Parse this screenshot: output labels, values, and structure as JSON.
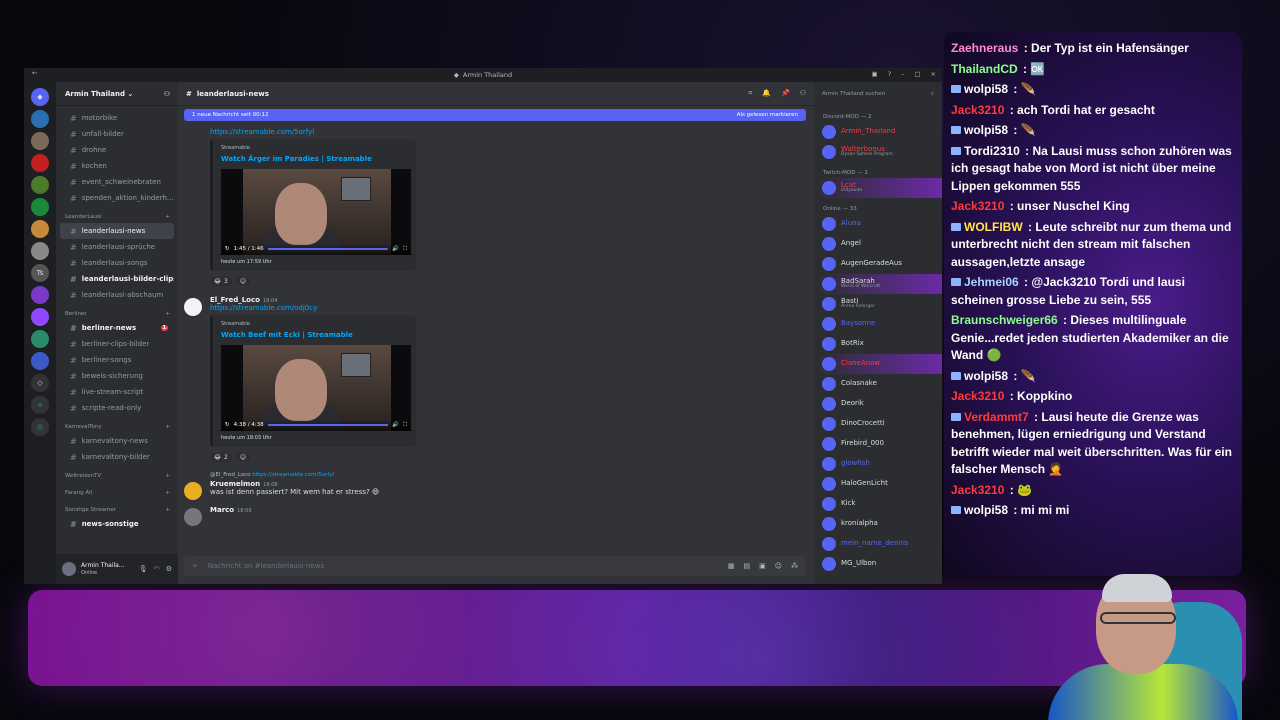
{
  "discord": {
    "window_title": "Armin Thailand",
    "guild_name": "Armin Thailand",
    "channels": [
      {
        "kind": "chan",
        "name": "motorbike"
      },
      {
        "kind": "chan",
        "name": "unfall-bilder"
      },
      {
        "kind": "chan",
        "name": "drohne"
      },
      {
        "kind": "chan",
        "name": "kochen"
      },
      {
        "kind": "chan",
        "name": "event_schweinebraten"
      },
      {
        "kind": "chan",
        "name": "spenden_aktion_kinderh..."
      },
      {
        "kind": "cat",
        "name": "LeanderLausi"
      },
      {
        "kind": "chan",
        "name": "leanderlausi-news",
        "active": true
      },
      {
        "kind": "chan",
        "name": "leanderlausi-sprüche"
      },
      {
        "kind": "chan",
        "name": "leanderlausi-songs"
      },
      {
        "kind": "chan",
        "name": "leanderlausi-bilder-clips",
        "unread": true
      },
      {
        "kind": "chan",
        "name": "leanderlausi-abschaum"
      },
      {
        "kind": "cat",
        "name": "Berliner"
      },
      {
        "kind": "chan",
        "name": "berliner-news",
        "unread": true,
        "badge": "1"
      },
      {
        "kind": "chan",
        "name": "berliner-clips-bilder"
      },
      {
        "kind": "chan",
        "name": "berliner-songs"
      },
      {
        "kind": "chan",
        "name": "beweis-sicherung"
      },
      {
        "kind": "chan",
        "name": "live-stream-script"
      },
      {
        "kind": "chan",
        "name": "scripte-read-only"
      },
      {
        "kind": "cat",
        "name": "KarnevalTony"
      },
      {
        "kind": "chan",
        "name": "karnevaltony-news"
      },
      {
        "kind": "chan",
        "name": "karnevaltony-bilder"
      },
      {
        "kind": "cat",
        "name": "WeltreisenTV"
      },
      {
        "kind": "cat",
        "name": "Farang Ali"
      },
      {
        "kind": "cat",
        "name": "Sonstige Streamer"
      },
      {
        "kind": "chan",
        "name": "news-sonstige",
        "unread": true
      }
    ],
    "user": {
      "name": "Armin Thaila...",
      "status": "Online"
    },
    "channel_header": "leanderlausi-news",
    "new_bar": {
      "text": "1 neue Nachricht seit 00:12",
      "mark": "Als gelesen markieren"
    },
    "embed1": {
      "link": "https://streamable.com/5orfyl",
      "provider": "Streamable",
      "title": "Watch Ärger im Paradies | Streamable",
      "progress_text": "1:45 / 1:46",
      "progress": 0.99,
      "timestamp": "heute um 17:59 Uhr",
      "reaction": "3"
    },
    "msg2": {
      "author": "El_Fred_Loco",
      "time": "18:04",
      "link": "https://streamable.com/odj0cy",
      "provider": "Streamable",
      "title": "Watch Beef mit Ecki | Streamable",
      "progress_text": "4:38 / 4:38",
      "progress": 1.0,
      "timestamp": "heute um 18:03 Uhr",
      "reaction": "2"
    },
    "reply": {
      "ref_author": "@El_Fred_Loco",
      "ref_text": "https://streamable.com/5orfyl"
    },
    "msg3": {
      "author": "Kruemelmon",
      "time": "18:08",
      "text": "was ist denn passiert? Mit wem hat er stress? 😄"
    },
    "msg4": {
      "author": "Marco",
      "time": "18:09"
    },
    "composer_placeholder": "Nachricht an #leanderlausi-news",
    "member_search": "Armin Thailand suchen",
    "members": [
      {
        "kind": "cat",
        "name": "Discord-MOD — 2"
      },
      {
        "kind": "mem",
        "name": "Armin_Thailand",
        "color": "#f23f43"
      },
      {
        "kind": "mem",
        "name": "Walterbonus",
        "sub": "Dyson Sphere Program",
        "color": "#f23f43"
      },
      {
        "kind": "cat",
        "name": "Twitch-MOD — 1"
      },
      {
        "kind": "mem",
        "name": "Lcat",
        "sub": "irl4youdo",
        "color": "#f23f43",
        "boost": true
      },
      {
        "kind": "cat",
        "name": "Online — 33"
      },
      {
        "kind": "mem",
        "name": "Aluna",
        "color": "#5865f2"
      },
      {
        "kind": "mem",
        "name": "Angel",
        "color": "#dbdee1"
      },
      {
        "kind": "mem",
        "name": "AugenGeradeAus",
        "color": "#dbdee1"
      },
      {
        "kind": "mem",
        "name": "BadSarah",
        "sub": "World of Warcraft",
        "color": "#dbdee1",
        "boost": true
      },
      {
        "kind": "mem",
        "name": "Basti",
        "sub": "Arena Reforger",
        "color": "#dbdee1"
      },
      {
        "kind": "mem",
        "name": "Baysonne",
        "color": "#5865f2"
      },
      {
        "kind": "mem",
        "name": "BotRix",
        "color": "#dbdee1",
        "tag": "APP"
      },
      {
        "kind": "mem",
        "name": "ClaneAnow",
        "color": "#f23f43",
        "boost": true
      },
      {
        "kind": "mem",
        "name": "Colasnake",
        "color": "#dbdee1"
      },
      {
        "kind": "mem",
        "name": "Deorik",
        "color": "#dbdee1"
      },
      {
        "kind": "mem",
        "name": "DinoCrocetti",
        "color": "#dbdee1"
      },
      {
        "kind": "mem",
        "name": "Firebird_000",
        "color": "#dbdee1"
      },
      {
        "kind": "mem",
        "name": "glowfish",
        "color": "#5865f2"
      },
      {
        "kind": "mem",
        "name": "HaloGenLicht",
        "color": "#dbdee1"
      },
      {
        "kind": "mem",
        "name": "Kick",
        "color": "#dbdee1",
        "tag": "APP"
      },
      {
        "kind": "mem",
        "name": "kronialpha",
        "color": "#dbdee1"
      },
      {
        "kind": "mem",
        "name": "mein_name_dennis",
        "color": "#5865f2"
      },
      {
        "kind": "mem",
        "name": "MG_Ulbon",
        "color": "#dbdee1"
      }
    ]
  },
  "chat": [
    {
      "user": "Zaehneraus",
      "color": "#ff8ad8",
      "text": " : Der Typ ist ein Hafensänger"
    },
    {
      "user": "ThailandCD",
      "color": "#8cff8c",
      "text": " : 🆗"
    },
    {
      "user": "wolpi58",
      "color": "#ffffff",
      "text": " : 🪶",
      "icon": true
    },
    {
      "user": "Jack3210",
      "color": "#ff3b3b",
      "text": " : ach Tordi hat er gesacht"
    },
    {
      "user": "wolpi58",
      "color": "#ffffff",
      "text": " : 🪶",
      "icon": true
    },
    {
      "user": "Tordi2310",
      "color": "#ffffff",
      "text": " : Na Lausi muss schon zuhören was ich gesagt habe von Mord ist nicht über meine Lippen gekommen 555",
      "icon": true
    },
    {
      "user": "Jack3210",
      "color": "#ff3b3b",
      "text": " : unser Nuschel King"
    },
    {
      "user": "WOLFIBW",
      "color": "#ffe44d",
      "text": " : Leute schreibt nur zum thema und unterbrecht nicht den stream mit falschen aussagen,letzte ansage",
      "icon": true
    },
    {
      "user": "Jehmei06",
      "color": "#a8d4ff",
      "text": " : @Jack3210 Tordi und lausi scheinen grosse Liebe zu sein, 555",
      "icon": true
    },
    {
      "user": "Braunschweiger66",
      "color": "#8cff8c",
      "text": " : Dieses multilinguale Genie...redet jeden studierten Akademiker an die Wand 🟢"
    },
    {
      "user": "wolpi58",
      "color": "#ffffff",
      "text": " : 🪶",
      "icon": true
    },
    {
      "user": "Jack3210",
      "color": "#ff3b3b",
      "text": " : Koppkino"
    },
    {
      "user": "Verdammt7",
      "color": "#ff3b3b",
      "text": " : Lausi heute die Grenze was benehmen, lügen erniedrigung und Verstand betrifft wieder mal weit überschritten. Was für ein falscher Mensch 🤦",
      "icon": true
    },
    {
      "user": "Jack3210",
      "color": "#ff3b3b",
      "text": " : 🐸"
    },
    {
      "user": "wolpi58",
      "color": "#ffffff",
      "text": " : mi mi mi",
      "icon": true
    }
  ]
}
